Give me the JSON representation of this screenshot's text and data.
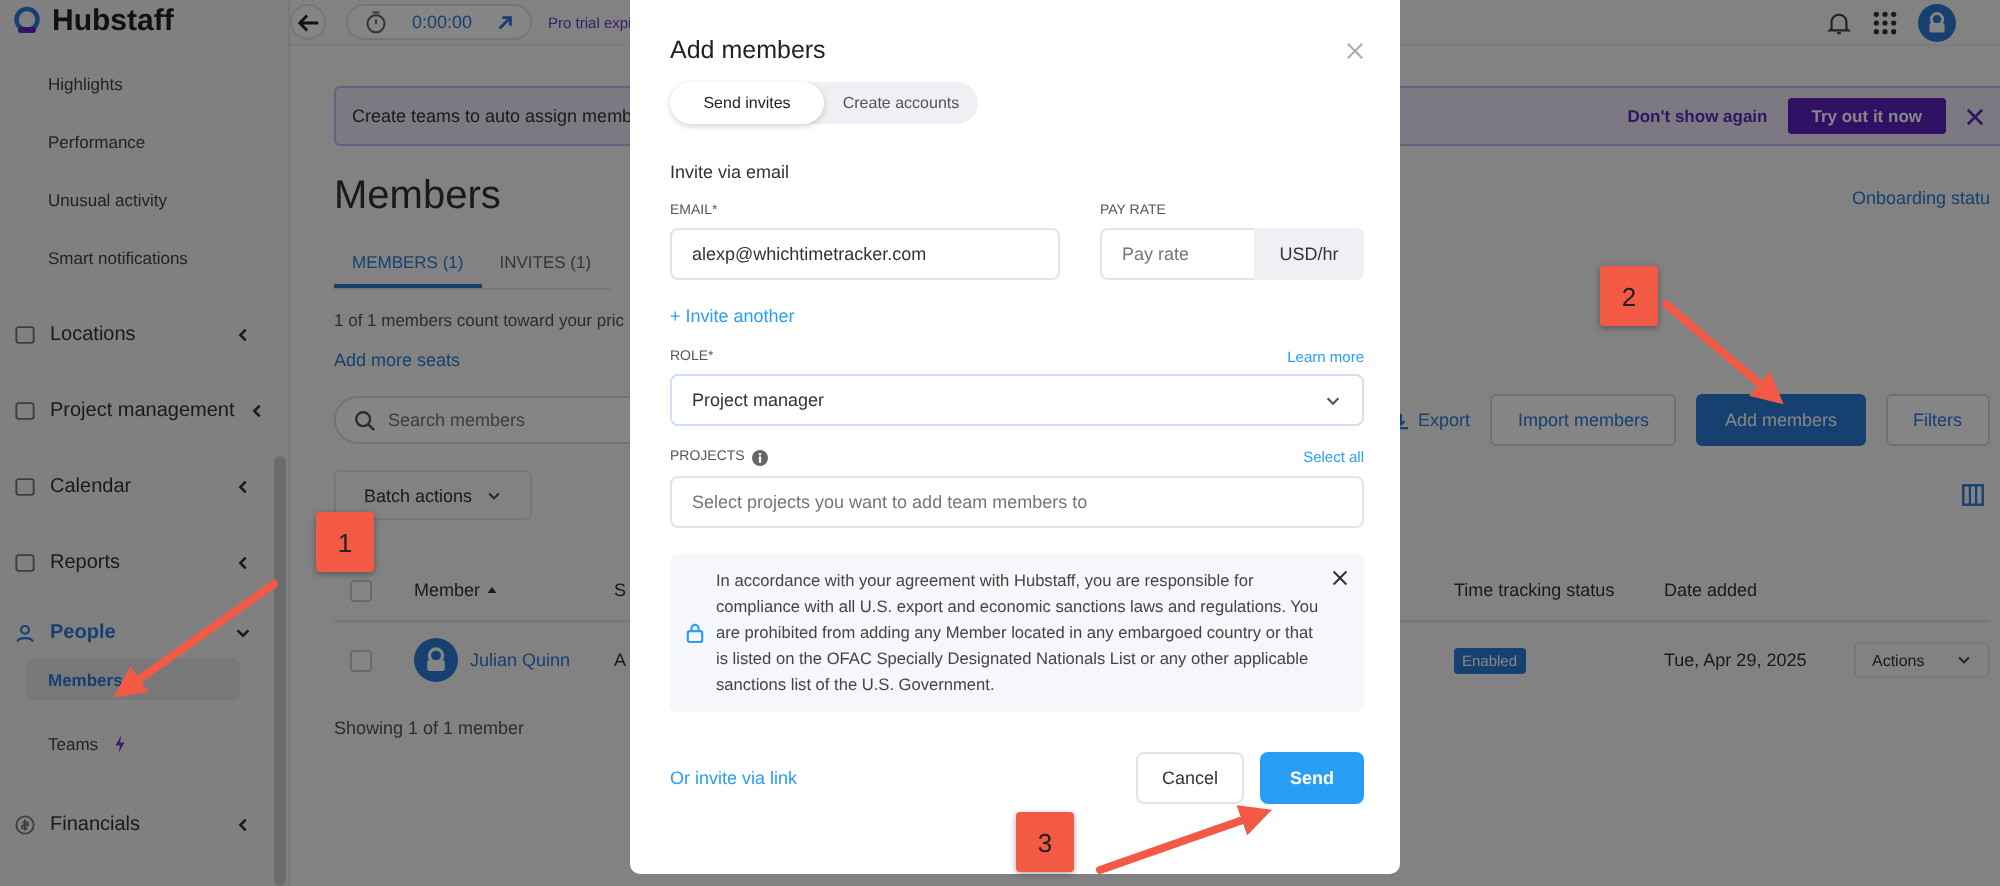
{
  "app": {
    "logo": "Hubstaff",
    "timer": "0:00:00",
    "trial_notice": "Pro trial expi"
  },
  "sidebar": {
    "items": [
      {
        "kind": "sub",
        "label": "Highlights",
        "selected": false
      },
      {
        "kind": "sub",
        "label": "Performance",
        "selected": false
      },
      {
        "kind": "sub",
        "label": "Unusual activity",
        "selected": false
      },
      {
        "kind": "sub",
        "label": "Smart notifications",
        "selected": false
      },
      {
        "kind": "group",
        "label": "Locations",
        "expanded": false
      },
      {
        "kind": "group",
        "label": "Project management",
        "expanded": false
      },
      {
        "kind": "group",
        "label": "Calendar",
        "expanded": false
      },
      {
        "kind": "group",
        "label": "Reports",
        "expanded": false
      },
      {
        "kind": "group",
        "label": "People",
        "expanded": true,
        "children": [
          {
            "label": "Members",
            "selected": true,
            "new_badge": false
          },
          {
            "label": "Teams",
            "selected": false,
            "new_badge": true
          }
        ]
      },
      {
        "kind": "group",
        "label": "Financials",
        "expanded": false
      }
    ]
  },
  "banner": {
    "text": "Create teams to auto assign memb",
    "dismiss": "Don't show again",
    "action": "Try out it now"
  },
  "page": {
    "title": "Members",
    "onboarding": "Onboarding statu",
    "tabs": [
      {
        "label": "MEMBERS (1)",
        "selected": true
      },
      {
        "label": "INVITES (1)",
        "selected": false
      }
    ],
    "seat_note": "1 of 1 members count toward your pric",
    "add_seats": "Add more seats",
    "search": {
      "placeholder": "Search members"
    },
    "buttons": {
      "export": "Export",
      "import": "Import members",
      "add": "Add members",
      "filters": "Filters"
    },
    "batch": "Batch actions",
    "table": {
      "all_selected": false,
      "columns": [
        "Member",
        "S",
        "Time tracking status",
        "Date added"
      ],
      "rows": [
        {
          "selected": false,
          "member": "Julian Quinn",
          "column_2": "A",
          "status": "Enabled",
          "date": "Tue, Apr 29, 2025",
          "actions": "Actions"
        }
      ]
    },
    "footer": "Showing 1 of 1 member"
  },
  "modal": {
    "title": "Add members",
    "modes": [
      {
        "label": "Send invites",
        "selected": true
      },
      {
        "label": "Create accounts",
        "selected": false
      }
    ],
    "section": "Invite via email",
    "email": {
      "label": "EMAIL*",
      "value": "alexp@whichtimetracker.com"
    },
    "pay_rate": {
      "label": "PAY RATE",
      "placeholder": "Pay rate",
      "unit": "USD/hr"
    },
    "invite_another": "+ Invite another",
    "role": {
      "label": "ROLE*",
      "learn_more": "Learn more",
      "value": "Project manager"
    },
    "projects": {
      "label": "PROJECTS",
      "select_all": "Select all",
      "placeholder": "Select projects you want to add team members to"
    },
    "notice": "In accordance with your agreement with Hubstaff, you are responsible for compliance with all U.S. export and economic sanctions laws and regulations. You are prohibited from adding any Member located in any embargoed country or that is listed on the OFAC Specially Designated Nationals List or any other applicable sanctions list of the U.S. Government.",
    "invite_link": "Or invite via link",
    "cancel": "Cancel",
    "send": "Send"
  },
  "annotations": [
    {
      "label": "1"
    },
    {
      "label": "2"
    },
    {
      "label": "3"
    }
  ]
}
